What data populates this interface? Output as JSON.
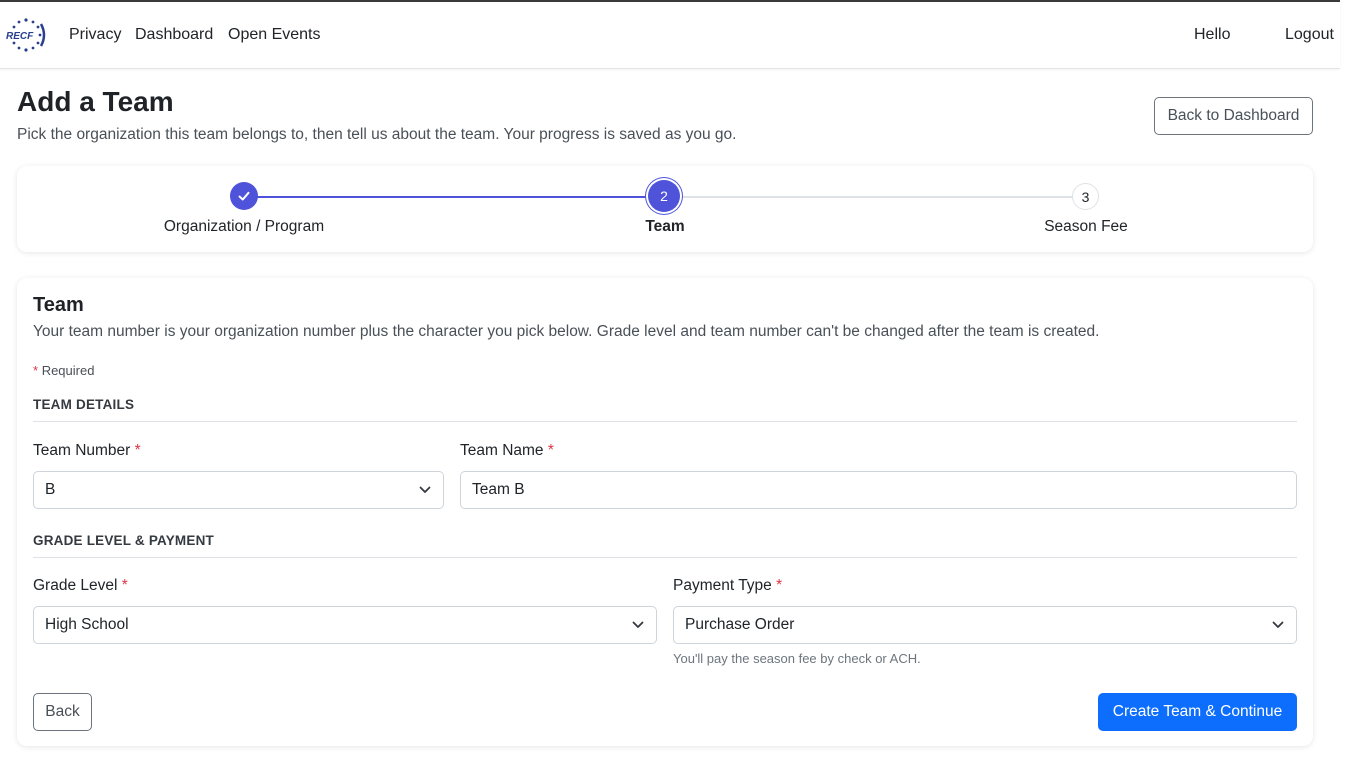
{
  "nav": {
    "logo_text": "RECF",
    "links": [
      "Privacy",
      "Dashboard",
      "Open Events"
    ],
    "greeting": "Hello",
    "logout": "Logout"
  },
  "header": {
    "title": "Add a Team",
    "subtitle": "Pick the organization this team belongs to, then tell us about the team. Your progress is saved as you go.",
    "back_to_dashboard": "Back to Dashboard"
  },
  "stepper": {
    "steps": [
      {
        "number": "1",
        "label": "Organization / Program",
        "state": "complete"
      },
      {
        "number": "2",
        "label": "Team",
        "state": "active"
      },
      {
        "number": "3",
        "label": "Season Fee",
        "state": "pending"
      }
    ],
    "colors": {
      "active": "#4f53d9",
      "pending_line": "#dee2e6"
    }
  },
  "form": {
    "title": "Team",
    "description": "Your team number is your organization number plus the character you pick below. Grade level and team number can't be changed after the team is created.",
    "required_star": "*",
    "required_note": "Required",
    "sections": {
      "team_details": "TEAM DETAILS",
      "grade_payment": "GRADE LEVEL & PAYMENT"
    },
    "team_number": {
      "label": "Team Number",
      "value": "B"
    },
    "team_name": {
      "label": "Team Name",
      "value": "Team B"
    },
    "grade_level": {
      "label": "Grade Level",
      "value": "High School"
    },
    "payment_type": {
      "label": "Payment Type",
      "value": "Purchase Order",
      "help": "You'll pay the season fee by check or ACH."
    },
    "back_button": "Back",
    "submit_button": "Create Team & Continue"
  },
  "colors": {
    "primary": "#0d6efd",
    "required": "#dc3545"
  }
}
